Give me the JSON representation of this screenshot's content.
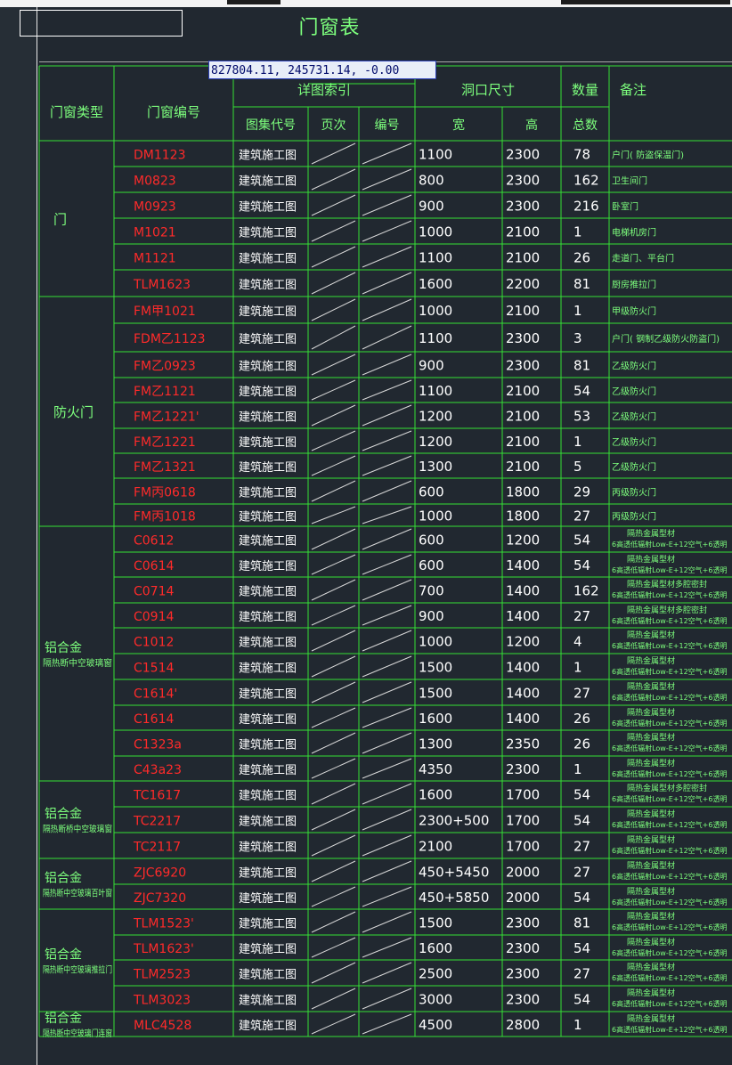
{
  "title": "门窗表",
  "coordinate_readout": "827804.11, 245731.14, -0.00",
  "headers": {
    "type": "门窗类型",
    "code": "门窗编号",
    "detail_index": "详图索引",
    "opening_size": "洞口尺寸",
    "quantity": "数量",
    "remarks": "备注",
    "atlas_code": "图集代号",
    "page": "页次",
    "number": "编号",
    "width": "宽",
    "height": "高",
    "total": "总数"
  },
  "groups": [
    {
      "label": "门",
      "sublabel": ""
    },
    {
      "label": "防火门",
      "sublabel": ""
    },
    {
      "label": "铝合金",
      "sublabel": "隔热断中空玻璃窗"
    },
    {
      "label": "铝合金",
      "sublabel": "隔热断桥中空玻璃窗"
    },
    {
      "label": "铝合金",
      "sublabel": "隔热断中空玻璃百叶窗"
    },
    {
      "label": "铝合金",
      "sublabel": "隔热断中空玻璃推拉门"
    },
    {
      "label": "铝合金",
      "sublabel": "隔热断中空玻璃门连窗"
    }
  ],
  "rows": [
    {
      "code": "DM1123",
      "atlas": "建筑施工图",
      "w": "1100",
      "h": "2300",
      "qty": "78",
      "note1": "户门( 防盗保温门)",
      "note2": ""
    },
    {
      "code": "M0823",
      "atlas": "建筑施工图",
      "w": "800",
      "h": "2300",
      "qty": "162",
      "note1": "卫生间门",
      "note2": ""
    },
    {
      "code": "M0923",
      "atlas": "建筑施工图",
      "w": "900",
      "h": "2300",
      "qty": "216",
      "note1": "卧室门",
      "note2": ""
    },
    {
      "code": "M1021",
      "atlas": "建筑施工图",
      "w": "1000",
      "h": "2100",
      "qty": "1",
      "note1": "电梯机房门",
      "note2": ""
    },
    {
      "code": "M1121",
      "atlas": "建筑施工图",
      "w": "1100",
      "h": "2100",
      "qty": "26",
      "note1": "走道门、平台门",
      "note2": ""
    },
    {
      "code": "TLM1623",
      "atlas": "建筑施工图",
      "w": "1600",
      "h": "2200",
      "qty": "81",
      "note1": "厨房推拉门",
      "note2": ""
    },
    {
      "code": "FM甲1021",
      "atlas": "建筑施工图",
      "w": "1000",
      "h": "2100",
      "qty": "1",
      "note1": "甲级防火门",
      "note2": ""
    },
    {
      "code": "FDM乙1123",
      "atlas": "建筑施工图",
      "w": "1100",
      "h": "2300",
      "qty": "3",
      "note1": "户门( 钢制乙级防火防盗门)",
      "note2": ""
    },
    {
      "code": "FM乙0923",
      "atlas": "建筑施工图",
      "w": "900",
      "h": "2300",
      "qty": "81",
      "note1": "乙级防火门",
      "note2": ""
    },
    {
      "code": "FM乙1121",
      "atlas": "建筑施工图",
      "w": "1100",
      "h": "2100",
      "qty": "54",
      "note1": "乙级防火门",
      "note2": ""
    },
    {
      "code": "FM乙1221'",
      "atlas": "建筑施工图",
      "w": "1200",
      "h": "2100",
      "qty": "53",
      "note1": "乙级防火门",
      "note2": ""
    },
    {
      "code": "FM乙1221",
      "atlas": "建筑施工图",
      "w": "1200",
      "h": "2100",
      "qty": "1",
      "note1": "乙级防火门",
      "note2": ""
    },
    {
      "code": "FM乙1321",
      "atlas": "建筑施工图",
      "w": "1300",
      "h": "2100",
      "qty": "5",
      "note1": "乙级防火门",
      "note2": ""
    },
    {
      "code": "FM丙0618",
      "atlas": "建筑施工图",
      "w": "600",
      "h": "1800",
      "qty": "29",
      "note1": "丙级防火门",
      "note2": ""
    },
    {
      "code": "FM丙1018",
      "atlas": "建筑施工图",
      "w": "1000",
      "h": "1800",
      "qty": "27",
      "note1": "丙级防火门",
      "note2": ""
    },
    {
      "code": "C0612",
      "atlas": "建筑施工图",
      "w": "600",
      "h": "1200",
      "qty": "54",
      "note1": "隔热金属型材",
      "note2": "6高透低辐射Low-E+12空气+6透明"
    },
    {
      "code": "C0614",
      "atlas": "建筑施工图",
      "w": "600",
      "h": "1400",
      "qty": "54",
      "note1": "隔热金属型材",
      "note2": "6高透低辐射Low-E+12空气+6透明"
    },
    {
      "code": "C0714",
      "atlas": "建筑施工图",
      "w": "700",
      "h": "1400",
      "qty": "162",
      "note1": "隔热金属型材多腔密封",
      "note2": "6高透低辐射Low-E+12空气+6透明"
    },
    {
      "code": "C0914",
      "atlas": "建筑施工图",
      "w": "900",
      "h": "1400",
      "qty": "27",
      "note1": "隔热金属型材多腔密封",
      "note2": "6高透低辐射Low-E+12空气+6透明"
    },
    {
      "code": "C1012",
      "atlas": "建筑施工图",
      "w": "1000",
      "h": "1200",
      "qty": "4",
      "note1": "隔热金属型材",
      "note2": "6高透低辐射Low-E+12空气+6透明"
    },
    {
      "code": "C1514",
      "atlas": "建筑施工图",
      "w": "1500",
      "h": "1400",
      "qty": "1",
      "note1": "隔热金属型材",
      "note2": "6高透低辐射Low-E+12空气+6透明"
    },
    {
      "code": "C1614'",
      "atlas": "建筑施工图",
      "w": "1500",
      "h": "1400",
      "qty": "27",
      "note1": "隔热金属型材",
      "note2": "6高透低辐射Low-E+12空气+6透明"
    },
    {
      "code": "C1614",
      "atlas": "建筑施工图",
      "w": "1600",
      "h": "1400",
      "qty": "26",
      "note1": "隔热金属型材",
      "note2": "6高透低辐射Low-E+12空气+6透明"
    },
    {
      "code": "C1323a",
      "atlas": "建筑施工图",
      "w": "1300",
      "h": "2350",
      "qty": "26",
      "note1": "隔热金属型材",
      "note2": "6高透低辐射Low-E+12空气+6透明"
    },
    {
      "code": "C43a23",
      "atlas": "建筑施工图",
      "w": "4350",
      "h": "2300",
      "qty": "1",
      "note1": "隔热金属型材",
      "note2": "6高透低辐射Low-E+12空气+6透明"
    },
    {
      "code": "TC1617",
      "atlas": "建筑施工图",
      "w": "1600",
      "h": "1700",
      "qty": "54",
      "note1": "隔热金属型材多腔密封",
      "note2": "6高透低辐射Low-E+12空气+6透明"
    },
    {
      "code": "TC2217",
      "atlas": "建筑施工图",
      "w": "2300+500",
      "h": "1700",
      "qty": "54",
      "note1": "隔热金属型材",
      "note2": "6高透低辐射Low-E+12空气+6透明"
    },
    {
      "code": "TC2117",
      "atlas": "建筑施工图",
      "w": "2100",
      "h": "1700",
      "qty": "27",
      "note1": "隔热金属型材",
      "note2": "6高透低辐射Low-E+12空气+6透明"
    },
    {
      "code": "ZJC6920",
      "atlas": "建筑施工图",
      "w": "450+5450",
      "h": "2000",
      "qty": "27",
      "note1": "隔热金属型材",
      "note2": "6高透低辐射Low-E+12空气+6透明"
    },
    {
      "code": "ZJC7320",
      "atlas": "建筑施工图",
      "w": "450+5850",
      "h": "2000",
      "qty": "54",
      "note1": "隔热金属型材",
      "note2": "6高透低辐射Low-E+12空气+6透明"
    },
    {
      "code": "TLM1523'",
      "atlas": "建筑施工图",
      "w": "1500",
      "h": "2300",
      "qty": "81",
      "note1": "隔热金属型材",
      "note2": "6高透低辐射Low-E+12空气+6透明"
    },
    {
      "code": "TLM1623'",
      "atlas": "建筑施工图",
      "w": "1600",
      "h": "2300",
      "qty": "54",
      "note1": "隔热金属型材",
      "note2": "6高透低辐射Low-E+12空气+6透明"
    },
    {
      "code": "TLM2523",
      "atlas": "建筑施工图",
      "w": "2500",
      "h": "2300",
      "qty": "27",
      "note1": "隔热金属型材",
      "note2": "6高透低辐射Low-E+12空气+6透明"
    },
    {
      "code": "TLM3023",
      "atlas": "建筑施工图",
      "w": "3000",
      "h": "2300",
      "qty": "54",
      "note1": "隔热金属型材",
      "note2": "6高透低辐射Low-E+12空气+6透明"
    },
    {
      "code": "MLC4528",
      "atlas": "建筑施工图",
      "w": "4500",
      "h": "2800",
      "qty": "1",
      "note1": "隔热金属型材",
      "note2": "6高透低辐射Low-E+12空气+6透明"
    }
  ],
  "colors": {
    "background": "#212830",
    "grid_line": "#35e035",
    "text_green": "#7dff7d",
    "code_red": "#ff2a2a",
    "divider_white": "#d8d8d8",
    "tooltip_bg": "#e8eef8"
  }
}
